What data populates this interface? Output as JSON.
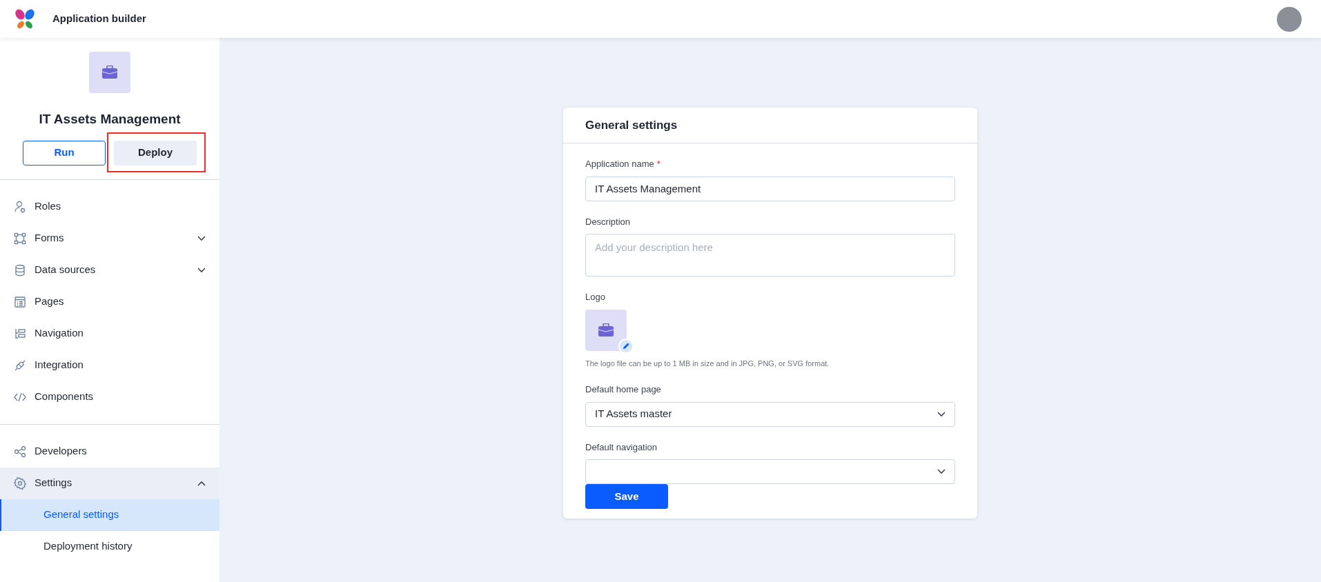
{
  "header": {
    "title": "Application builder"
  },
  "app": {
    "name": "IT Assets Management",
    "buttons": [
      {
        "label": "Run",
        "kind": "outline",
        "highlighted": false
      },
      {
        "label": "Deploy",
        "kind": "secondary",
        "highlighted": true
      }
    ]
  },
  "sidebar": {
    "sections": [
      [
        {
          "label": "Roles"
        },
        {
          "label": "Forms",
          "expanded": false
        },
        {
          "label": "Data sources",
          "expanded": false
        },
        {
          "label": "Pages"
        },
        {
          "label": "Navigation"
        },
        {
          "label": "Integration"
        },
        {
          "label": "Components"
        }
      ],
      [
        {
          "label": "Developers"
        },
        {
          "label": "Settings",
          "expanded": true,
          "children": [
            {
              "label": "General settings",
              "selected": true
            },
            {
              "label": "Deployment history",
              "selected": false
            }
          ]
        }
      ]
    ]
  },
  "card": {
    "title": "General settings",
    "fields": [
      {
        "kind": "text",
        "label": "Application name",
        "required_mark": "*",
        "value": "IT Assets Management"
      },
      {
        "kind": "textarea",
        "label": "Description",
        "placeholder": "Add your description here"
      },
      {
        "kind": "logo",
        "label": "Logo",
        "hint": "The logo file can be up to 1 MB in size and in JPG, PNG, or SVG format."
      },
      {
        "kind": "select",
        "label": "Default home page",
        "value": "IT Assets master"
      },
      {
        "kind": "select",
        "label": "Default navigation"
      }
    ],
    "save": "Save"
  }
}
